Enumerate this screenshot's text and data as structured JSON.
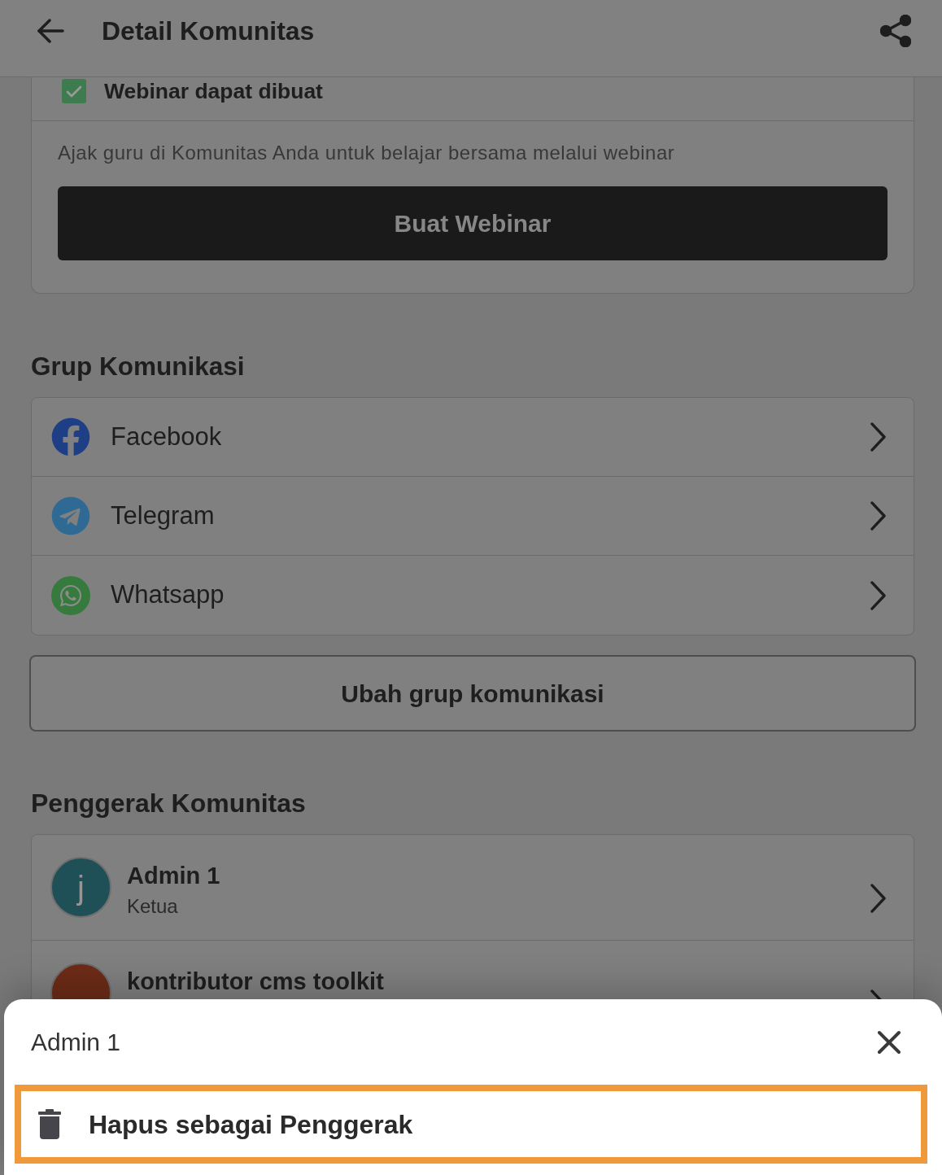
{
  "header": {
    "title": "Detail Komunitas"
  },
  "webinar_card": {
    "checkbox": {
      "label": "Webinar dapat dibuat",
      "checked": true
    },
    "description": "Ajak guru di Komunitas Anda untuk belajar bersama melalui webinar",
    "button": "Buat Webinar"
  },
  "communication_groups": {
    "heading": "Grup Komunikasi",
    "items": [
      {
        "kind": "facebook",
        "label": "Facebook"
      },
      {
        "kind": "telegram",
        "label": "Telegram"
      },
      {
        "kind": "whatsapp",
        "label": "Whatsapp"
      }
    ],
    "button": "Ubah grup komunikasi"
  },
  "community_leaders": {
    "heading": "Penggerak Komunitas",
    "members": [
      {
        "initial": "j",
        "name": "Admin 1",
        "role": "Ketua",
        "color": "#1f4f57"
      },
      {
        "name": "kontributor cms toolkit",
        "color": "#6d2c17"
      }
    ]
  },
  "bottom_sheet": {
    "title": "Admin 1",
    "actions": [
      {
        "label": "Hapus sebagai Penggerak",
        "highlighted": true
      }
    ]
  }
}
